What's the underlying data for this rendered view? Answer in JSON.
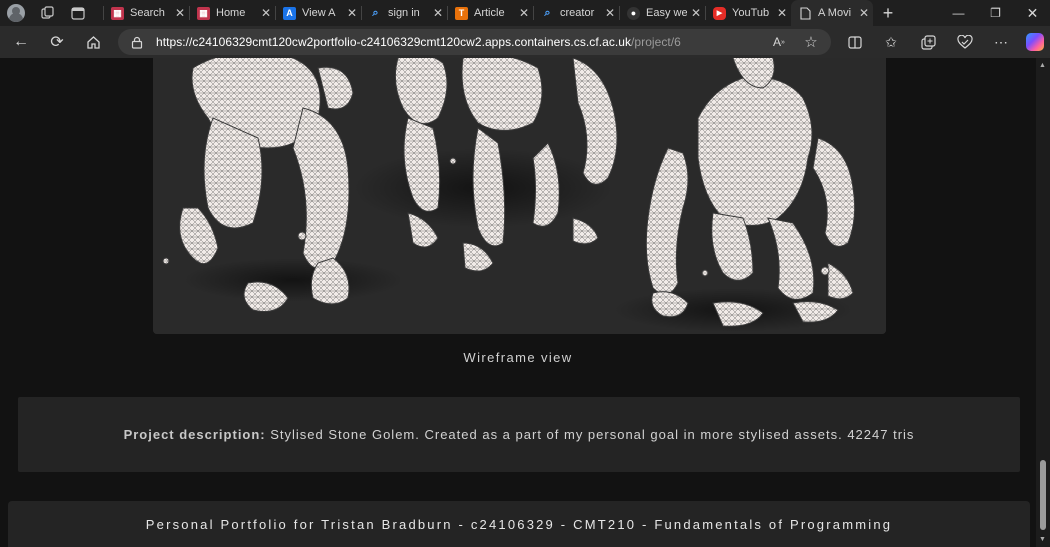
{
  "browser": {
    "tabs": [
      {
        "title": "Search",
        "favicon_color": "#c0344d",
        "favicon_icon": "grid-icon"
      },
      {
        "title": "Home",
        "favicon_color": "#c0344d",
        "favicon_icon": "grid-icon"
      },
      {
        "title": "View A",
        "favicon_color": "#1a73e8",
        "favicon_icon": "a-logo-icon"
      },
      {
        "title": "sign in",
        "favicon_color": "#1f1f1f",
        "favicon_icon": "search-icon"
      },
      {
        "title": "Article",
        "favicon_color": "#e8710a",
        "favicon_icon": "t-logo-icon"
      },
      {
        "title": "creator",
        "favicon_color": "#1f1f1f",
        "favicon_icon": "search-icon"
      },
      {
        "title": "Easy we",
        "favicon_color": "#333333",
        "favicon_icon": "circle-logo-icon"
      },
      {
        "title": "YouTub",
        "favicon_color": "#e52d27",
        "favicon_icon": "youtube-icon"
      },
      {
        "title": "A Movi",
        "favicon_color": "#2b2b2b",
        "favicon_icon": "page-icon",
        "active": true
      }
    ],
    "url": {
      "host": "https://c24106329cmt120cw2portfolio-c24106329cmt120cw2.apps.containers.cs.cf.ac.uk",
      "path": "/project/6"
    }
  },
  "page": {
    "image_alt": "Stone golem wireframe renders",
    "caption": "Wireframe view",
    "description_label": "Project description:",
    "description_text": " Stylised Stone Golem. Created as a part of my personal goal in more stylised assets. 42247 tris",
    "footer": "Personal Portfolio for Tristan Bradburn - c24106329 - CMT210 - Fundamentals of Programming"
  }
}
